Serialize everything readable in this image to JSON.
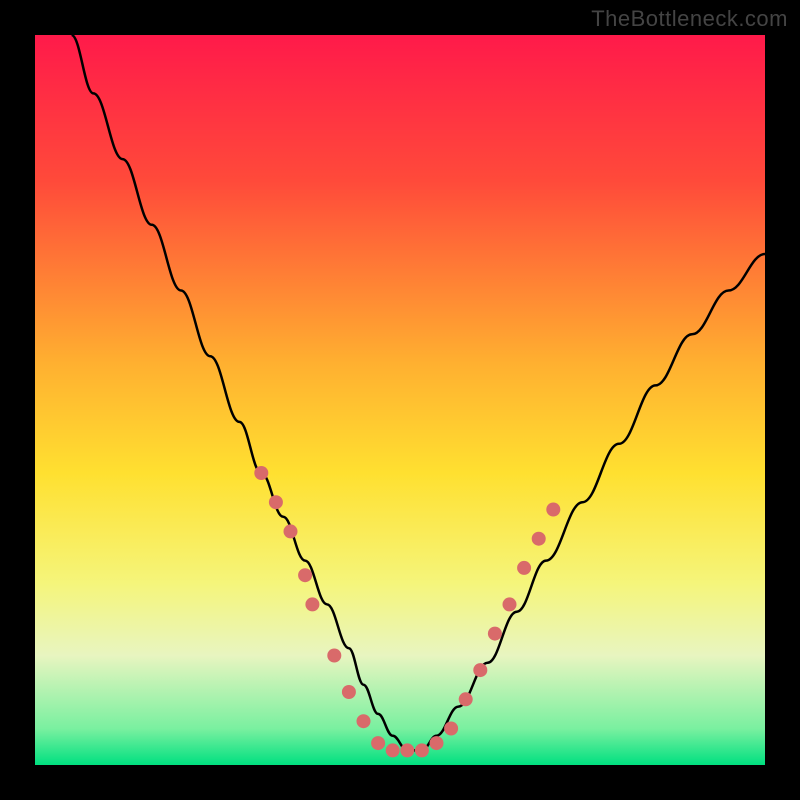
{
  "watermark": "TheBottleneck.com",
  "chart_data": {
    "type": "line",
    "title": "",
    "xlabel": "",
    "ylabel": "",
    "xlim": [
      0,
      100
    ],
    "ylim": [
      0,
      100
    ],
    "gradient_stops": [
      {
        "offset": 0,
        "color": "#ff1a4a"
      },
      {
        "offset": 20,
        "color": "#ff4a3a"
      },
      {
        "offset": 45,
        "color": "#ffb030"
      },
      {
        "offset": 60,
        "color": "#ffe030"
      },
      {
        "offset": 75,
        "color": "#f5f57a"
      },
      {
        "offset": 85,
        "color": "#e8f5c0"
      },
      {
        "offset": 95,
        "color": "#7af0a0"
      },
      {
        "offset": 100,
        "color": "#00e080"
      }
    ],
    "series": [
      {
        "name": "bottleneck-curve",
        "x": [
          5,
          8,
          12,
          16,
          20,
          24,
          28,
          31,
          34,
          37,
          40,
          43,
          45,
          47,
          49,
          51,
          53,
          55,
          58,
          62,
          66,
          70,
          75,
          80,
          85,
          90,
          95,
          100
        ],
        "y": [
          100,
          92,
          83,
          74,
          65,
          56,
          47,
          40,
          34,
          28,
          22,
          16,
          11,
          7,
          4,
          2,
          2,
          4,
          8,
          14,
          21,
          28,
          36,
          44,
          52,
          59,
          65,
          70
        ]
      }
    ],
    "markers": {
      "name": "highlight-dots",
      "color": "#d96a6a",
      "radius": 7,
      "points": [
        {
          "x": 31,
          "y": 40
        },
        {
          "x": 33,
          "y": 36
        },
        {
          "x": 35,
          "y": 32
        },
        {
          "x": 37,
          "y": 26
        },
        {
          "x": 38,
          "y": 22
        },
        {
          "x": 41,
          "y": 15
        },
        {
          "x": 43,
          "y": 10
        },
        {
          "x": 45,
          "y": 6
        },
        {
          "x": 47,
          "y": 3
        },
        {
          "x": 49,
          "y": 2
        },
        {
          "x": 51,
          "y": 2
        },
        {
          "x": 53,
          "y": 2
        },
        {
          "x": 55,
          "y": 3
        },
        {
          "x": 57,
          "y": 5
        },
        {
          "x": 59,
          "y": 9
        },
        {
          "x": 61,
          "y": 13
        },
        {
          "x": 63,
          "y": 18
        },
        {
          "x": 65,
          "y": 22
        },
        {
          "x": 67,
          "y": 27
        },
        {
          "x": 69,
          "y": 31
        },
        {
          "x": 71,
          "y": 35
        }
      ]
    }
  }
}
